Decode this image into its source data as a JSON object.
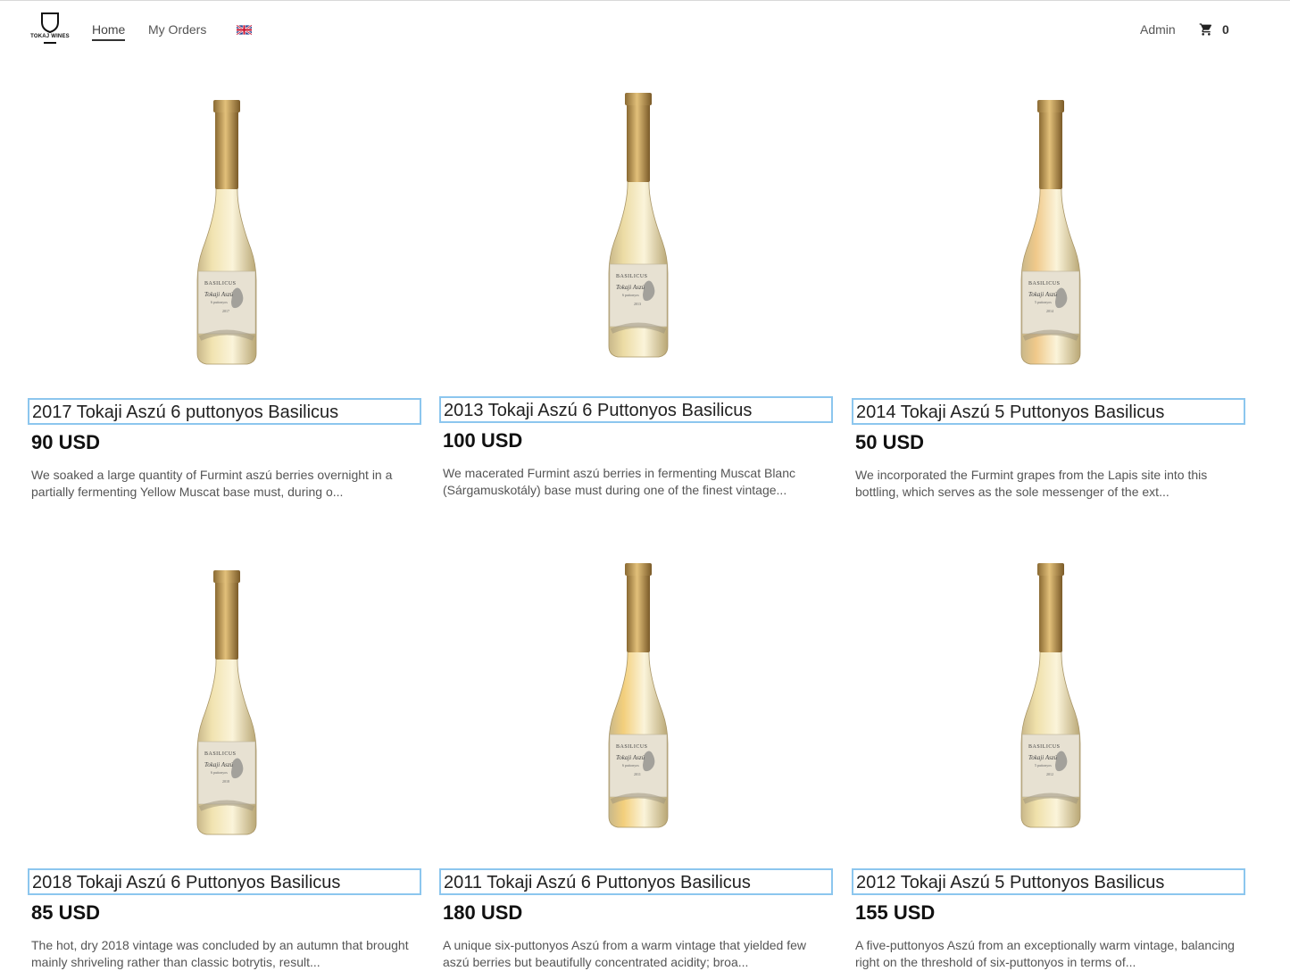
{
  "nav": {
    "logo_text": "TOKAJ WINES",
    "home": "Home",
    "orders": "My Orders",
    "flag": "uk-flag-icon",
    "admin": "Admin",
    "cart_icon": "cart-icon",
    "cart_count": "0"
  },
  "products": [
    {
      "title": "2017 Tokaji Aszú 6 puttonyos Basilicus",
      "price": "90 USD",
      "desc": "We soaked a large quantity of Furmint aszú berries overnight in a partially fermenting Yellow Muscat base must, during o...",
      "label_brand": "BASILICUS",
      "label_name": "Tokaji Aszú",
      "label_sub": "6 puttonyos",
      "label_year": "2017",
      "wine_color": "#f1e3b0"
    },
    {
      "title": "2013 Tokaji Aszú 6 Puttonyos Basilicus",
      "price": "100 USD",
      "desc": "We macerated Furmint aszú berries in fermenting Muscat Blanc (Sárgamuskotály) base must during one of the finest vintage...",
      "label_brand": "BASILICUS",
      "label_name": "Tokaji Aszú",
      "label_sub": "6 puttonyos",
      "label_year": "2013",
      "wine_color": "#ecdca5"
    },
    {
      "title": "2014 Tokaji Aszú 5 Puttonyos Basilicus",
      "price": "50 USD",
      "desc": "We incorporated the Furmint grapes from the Lapis site into this bottling, which serves as the sole messenger of the ext...",
      "label_brand": "BASILICUS",
      "label_name": "Tokaji Aszú",
      "label_sub": "5 puttonyos",
      "label_year": "2014",
      "wine_color": "#f0c98a"
    },
    {
      "title": "2018 Tokaji Aszú 6 Puttonyos Basilicus",
      "price": "85 USD",
      "desc": "The hot, dry 2018 vintage was concluded by an autumn that brought mainly shriveling rather than classic botrytis, result...",
      "label_brand": "BASILICUS",
      "label_name": "Tokaji Aszú",
      "label_sub": "6 puttonyos",
      "label_year": "2018",
      "wine_color": "#f1e3b0"
    },
    {
      "title": "2011 Tokaji Aszú 6 Puttonyos Basilicus",
      "price": "180 USD",
      "desc": "A unique six-puttonyos Aszú from a warm vintage that yielded few aszú berries but beautifully concentrated acidity; broa...",
      "label_brand": "BASILICUS",
      "label_name": "Tokaji Aszú",
      "label_sub": "6 puttonyos",
      "label_year": "2011",
      "wine_color": "#f3cf7c"
    },
    {
      "title": "2012 Tokaji Aszú 5 Puttonyos Basilicus",
      "price": "155 USD",
      "desc": "A five-puttonyos Aszú from an exceptionally warm vintage, balancing right on the threshold of six-puttonyos in terms of...",
      "label_brand": "BASILICUS",
      "label_name": "Tokaji Aszú",
      "label_sub": "5 puttonyos",
      "label_year": "2012",
      "wine_color": "#efe0aa"
    }
  ]
}
